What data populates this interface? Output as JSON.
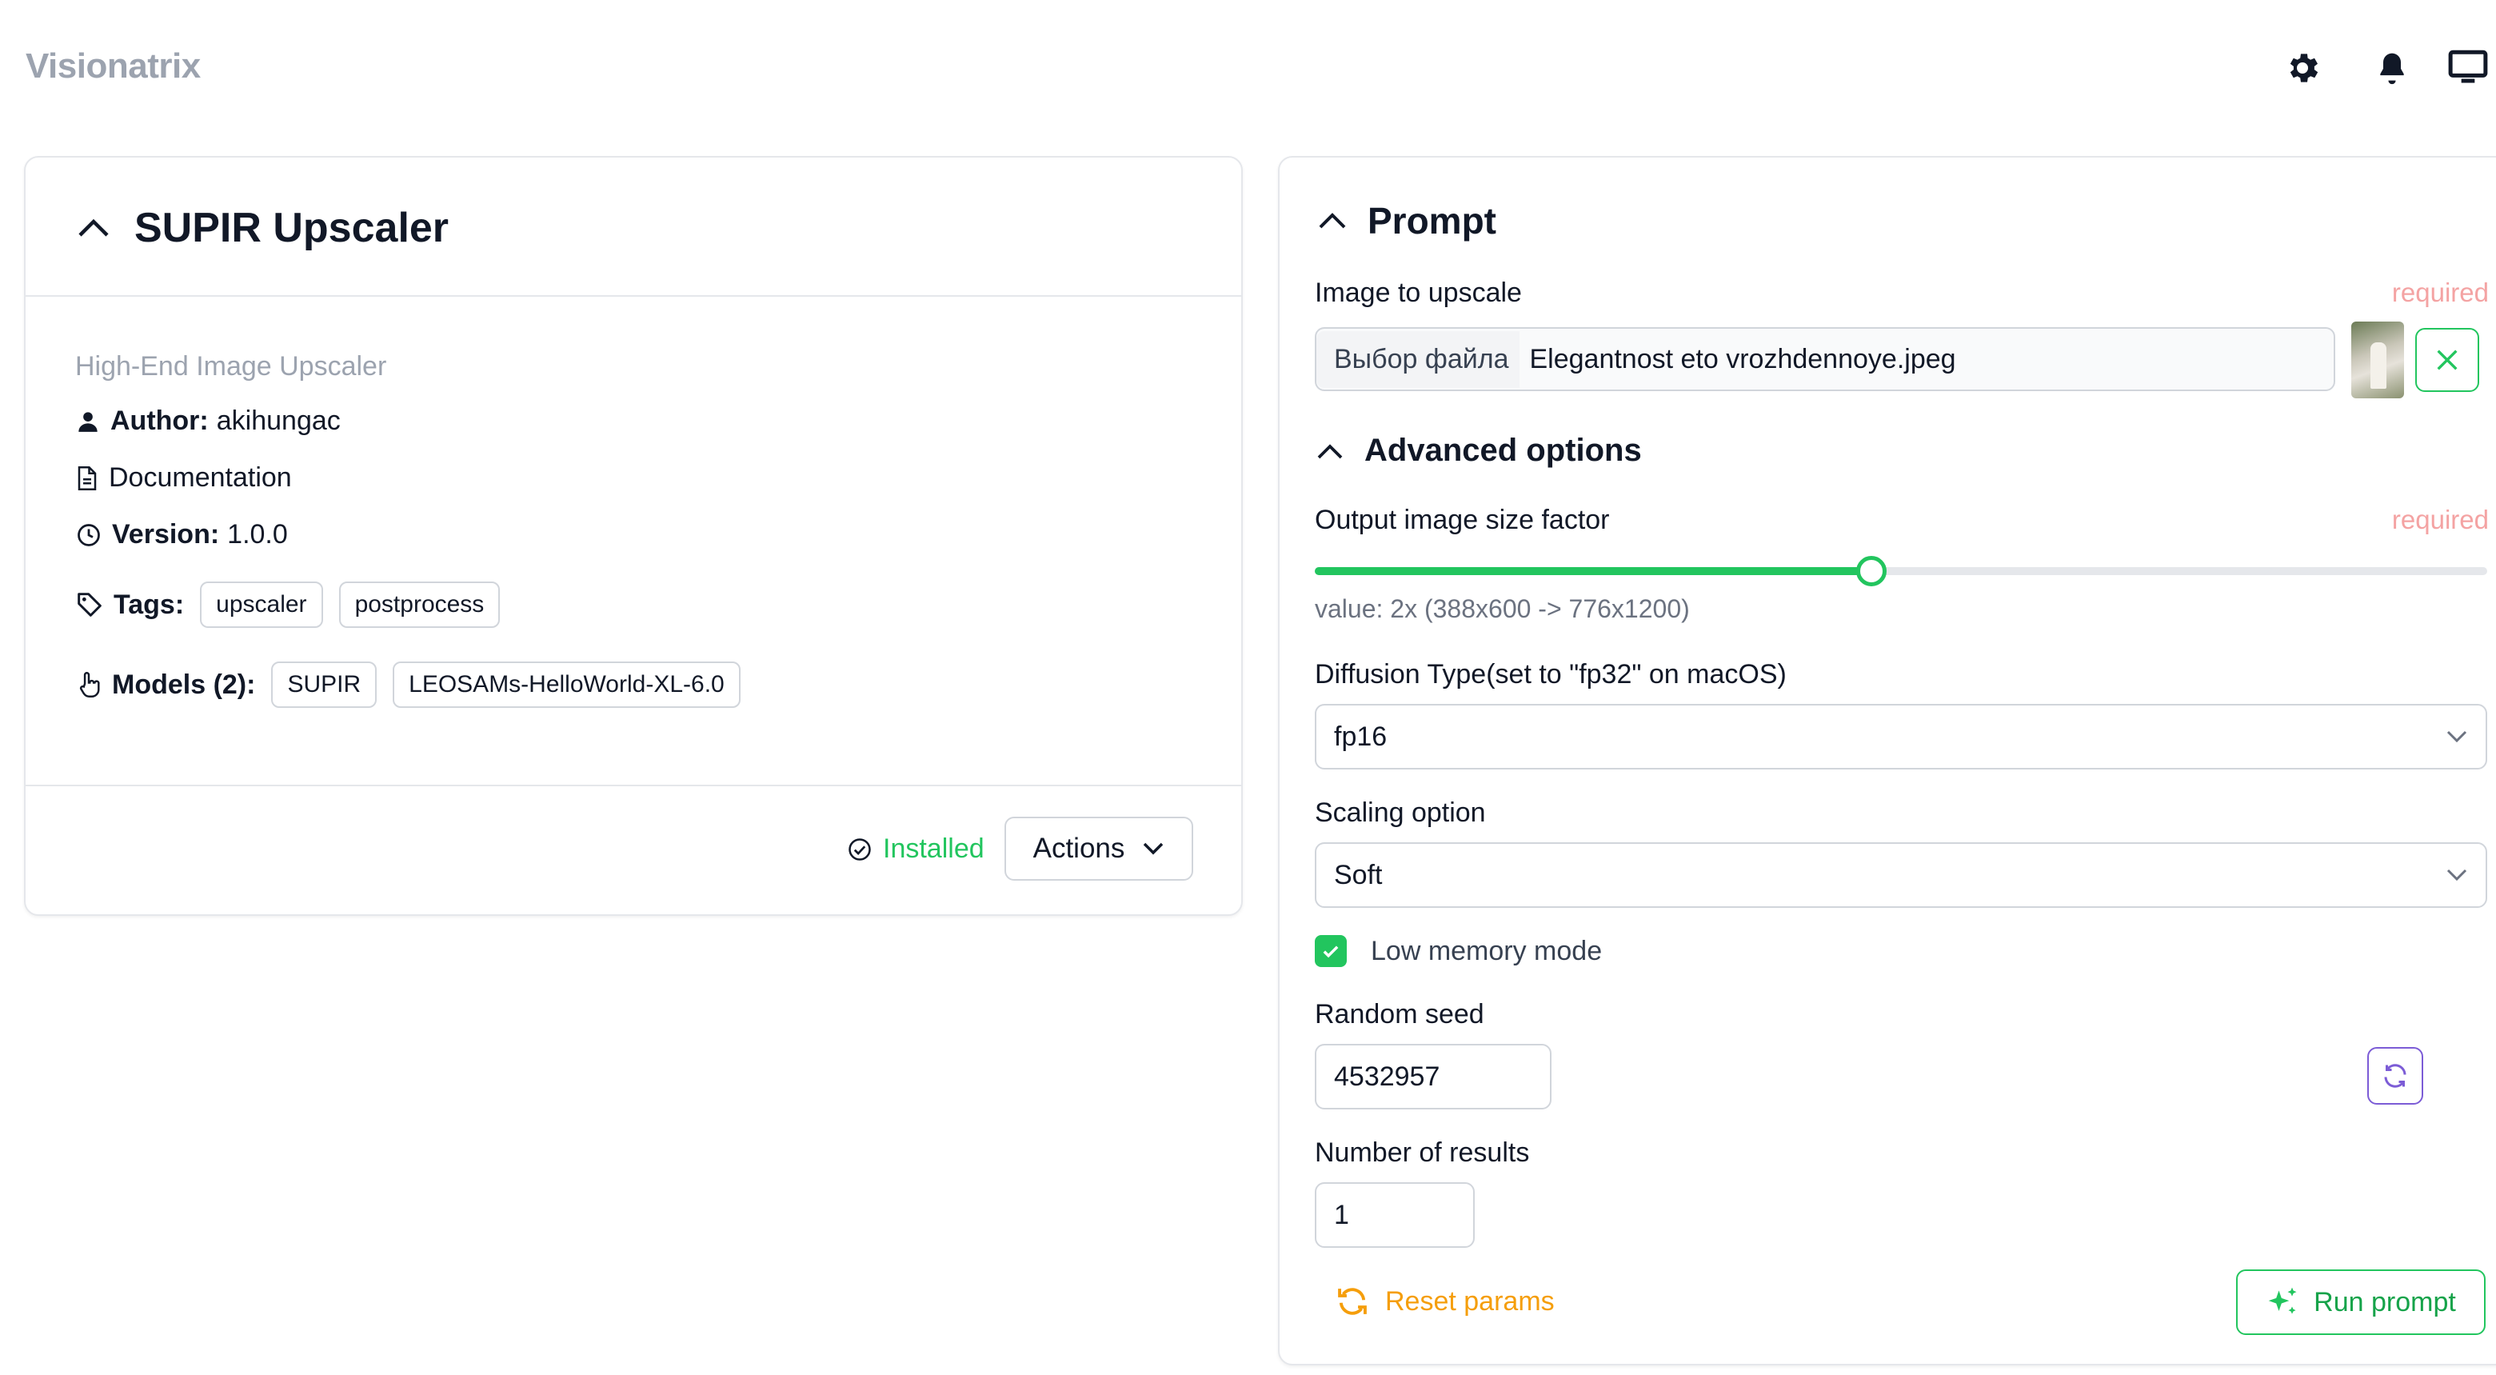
{
  "app": {
    "title": "Visionatrix"
  },
  "left_card": {
    "title": "SUPIR Upscaler",
    "subtitle": "High-End Image Upscaler",
    "author_label": "Author:",
    "author_value": "akihungac",
    "documentation_label": "Documentation",
    "version_label": "Version:",
    "version_value": "1.0.0",
    "tags_label": "Tags:",
    "tags": [
      "upscaler",
      "postprocess"
    ],
    "models_label": "Models (2):",
    "models": [
      "SUPIR",
      "LEOSAMs-HelloWorld-XL-6.0"
    ],
    "installed_label": "Installed",
    "actions_label": "Actions"
  },
  "prompt": {
    "title": "Prompt",
    "image_label": "Image to upscale",
    "required_label": "required",
    "file_button_label": "Выбор файла",
    "file_name": "Elegantnost eto vrozhdennoye.jpeg",
    "advanced_title": "Advanced options",
    "size_factor_label": "Output image size factor",
    "size_factor_fraction": 0.475,
    "size_factor_value_text": "value: 2x (388x600 -> 776x1200)",
    "diffusion_label": "Diffusion Type(set to \"fp32\" on macOS)",
    "diffusion_value": "fp16",
    "scaling_label": "Scaling option",
    "scaling_value": "Soft",
    "low_memory_label": "Low memory mode",
    "low_memory_checked": true,
    "seed_label": "Random seed",
    "seed_value": "4532957",
    "num_results_label": "Number of results",
    "num_results_value": "1",
    "reset_label": "Reset params",
    "run_label": "Run prompt"
  },
  "colors": {
    "accent_green": "#22c55e",
    "reset_orange": "#f59e0b",
    "required_red": "#f4a3a3",
    "seed_button_purple": "#7c5cd6"
  },
  "icons": [
    "gear-icon",
    "bell-icon",
    "monitor-icon",
    "chevron-up-icon",
    "user-icon",
    "document-icon",
    "clock-icon",
    "tag-icon",
    "pointer-icon",
    "check-circle-icon",
    "chevron-down-icon",
    "close-icon",
    "refresh-icon",
    "sparkles-icon"
  ]
}
